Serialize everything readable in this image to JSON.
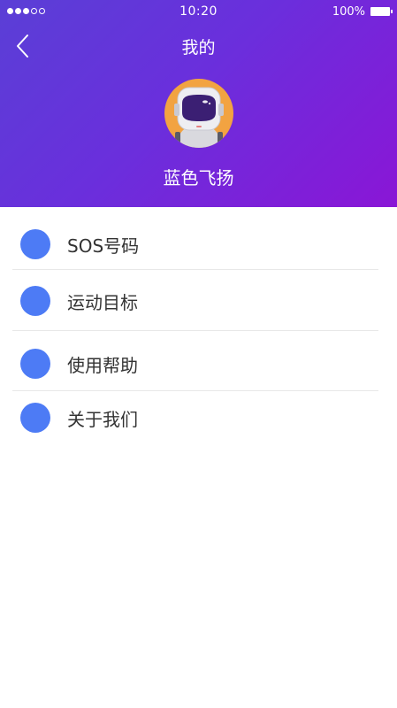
{
  "status_bar": {
    "time": "10:20",
    "battery_percent": "100%",
    "signal_strength": 3,
    "signal_max": 5
  },
  "nav": {
    "title": "我的",
    "back_icon": "chevron-left-icon"
  },
  "profile": {
    "avatar_icon": "astronaut-avatar",
    "username": "蓝色飞扬"
  },
  "menu": {
    "items": [
      {
        "label": "SOS号码",
        "icon": "dot-icon"
      },
      {
        "label": "运动目标",
        "icon": "dot-icon"
      },
      {
        "label": "使用帮助",
        "icon": "dot-icon"
      },
      {
        "label": "关于我们",
        "icon": "dot-icon"
      }
    ]
  },
  "colors": {
    "header_gradient_start": "#5a3fd6",
    "header_gradient_end": "#8a16d6",
    "avatar_bg": "#f2a341",
    "menu_bullet": "#4d7bf5",
    "text_primary": "#333333"
  }
}
